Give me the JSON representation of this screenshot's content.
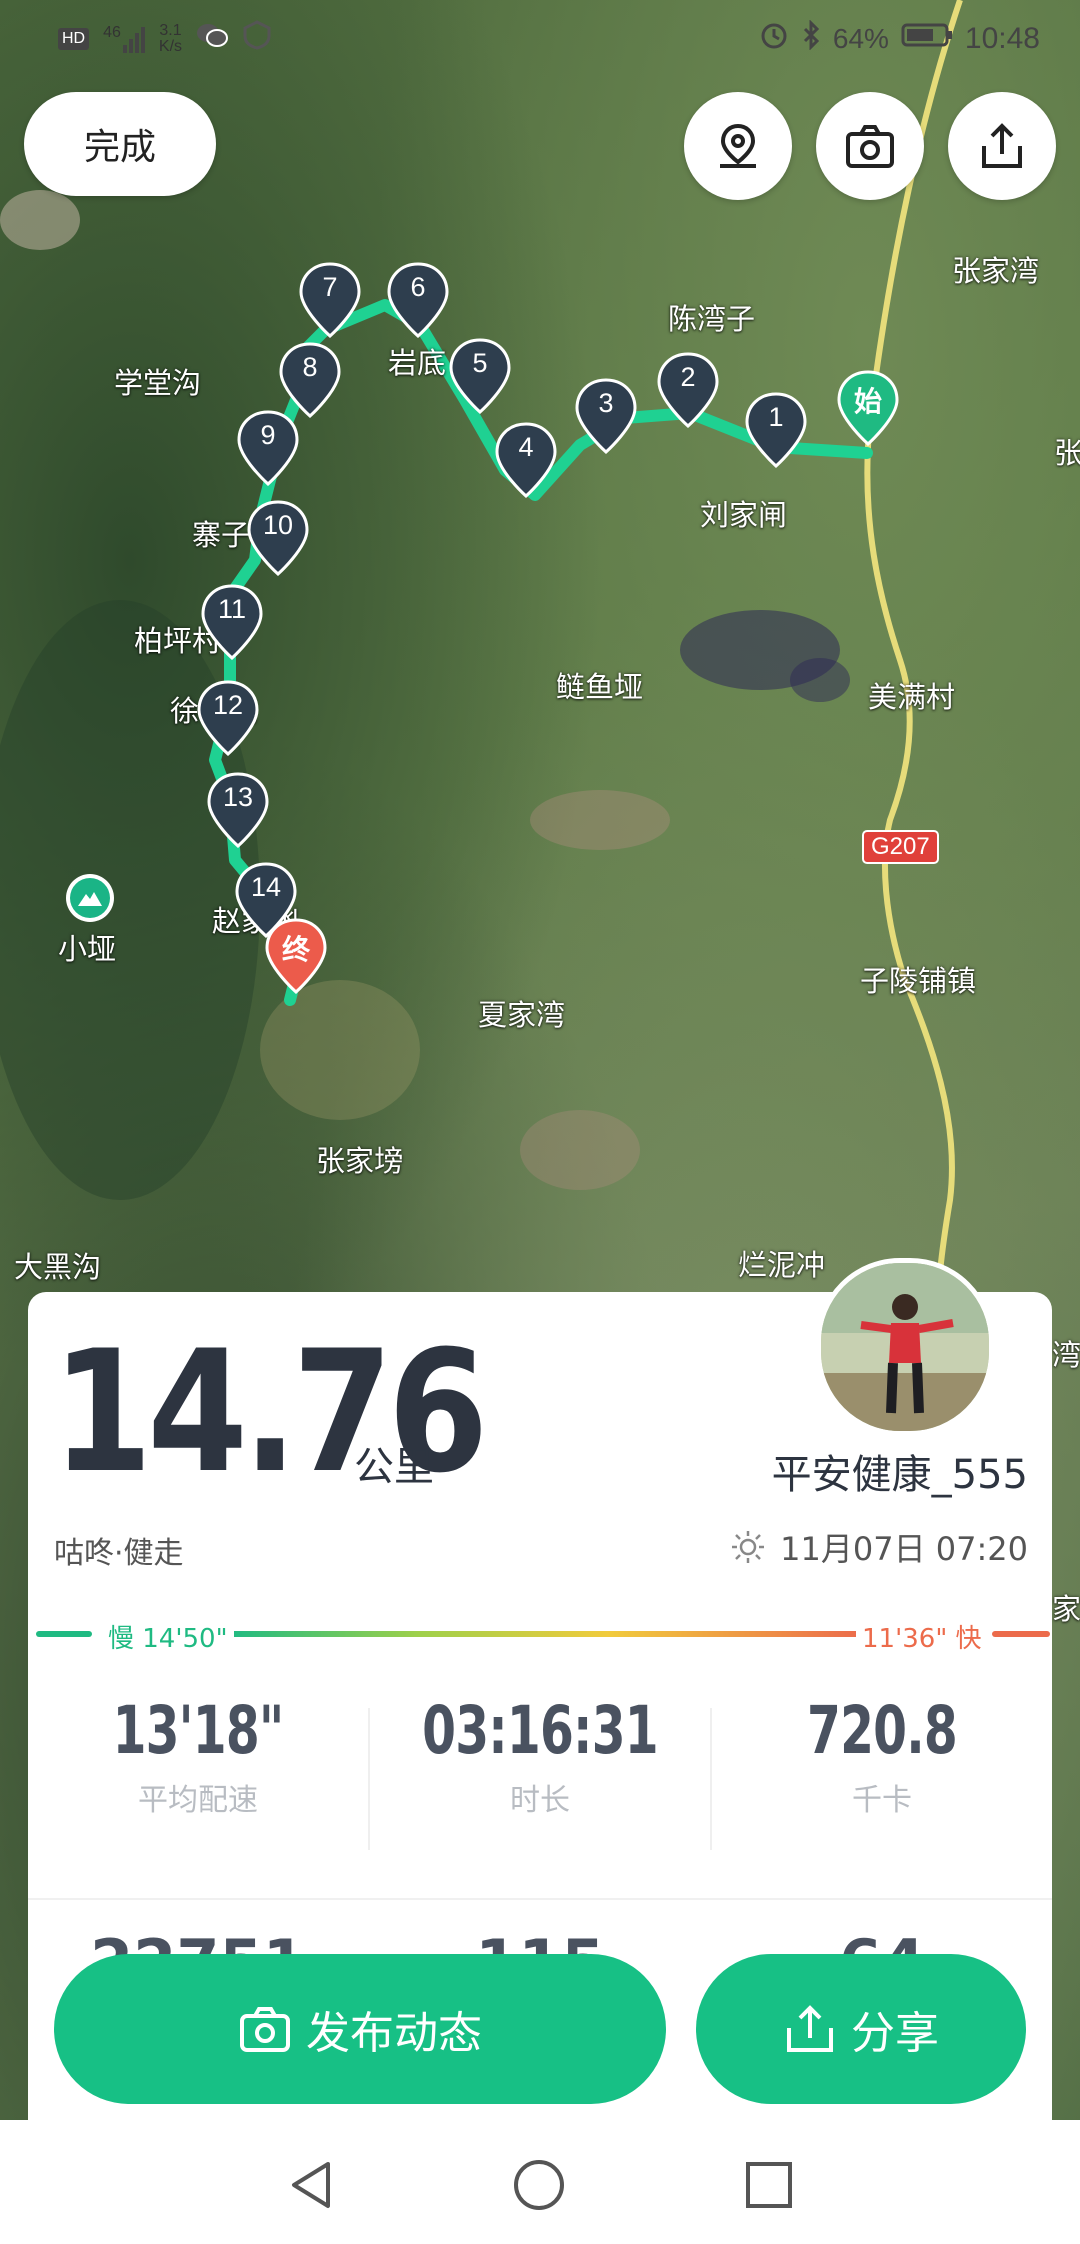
{
  "status_bar": {
    "left_badge": "HD",
    "signal": "46",
    "speed_value": "3.1",
    "speed_unit": "K/s",
    "battery_percent": "64%",
    "time": "10:48"
  },
  "top_bar": {
    "done_label": "完成"
  },
  "map": {
    "places": {
      "zhangjiawan_ne": "张家湾",
      "chenwanzi": "陈湾子",
      "xuetanggou": "学堂沟",
      "yandi": "岩底",
      "liujiazha": "刘家闸",
      "zhaizi": "寨子",
      "baipingtou": "柏坪村",
      "xiaoyuan": "徐家院",
      "lianyuya": "鲢鱼垭",
      "meimancun": "美满村",
      "xiaoya": "小垭",
      "zhaojiaao": "赵家凼",
      "zilingpuzhen": "子陵铺镇",
      "xiajiawan": "夏家湾",
      "zhangjiabang": "张家塝",
      "dahaigou": "大黑沟",
      "lanniichong": "烂泥冲",
      "zhang_edge": "张",
      "wan_edge": "湾",
      "jia_edge": "家"
    },
    "road_badge": "G207",
    "start_label": "始",
    "end_label": "终",
    "waypoints": [
      "1",
      "2",
      "3",
      "4",
      "5",
      "6",
      "7",
      "8",
      "9",
      "10",
      "11",
      "12",
      "13",
      "14"
    ],
    "route_color": "#1fd192"
  },
  "summary": {
    "distance": "14.76",
    "distance_unit": "公里",
    "username": "平安健康_555",
    "activity_type": "咕咚·健走",
    "datetime": "11月07日 07:20",
    "pace_slow_label": "慢 14'50\"",
    "pace_fast_label": "11'36\" 快",
    "stats": [
      {
        "value": "13'18\"",
        "label": "平均配速"
      },
      {
        "value": "03:16:31",
        "label": "时长"
      },
      {
        "value": "720.8",
        "label": "千卡"
      }
    ],
    "stats_row2": [
      "22751",
      "115",
      "64"
    ]
  },
  "actions": {
    "publish_label": "发布动态",
    "share_label": "分享"
  },
  "colors": {
    "accent": "#17c085",
    "pace_fast": "#ec6b4b",
    "marker": "#2e3e4e"
  }
}
